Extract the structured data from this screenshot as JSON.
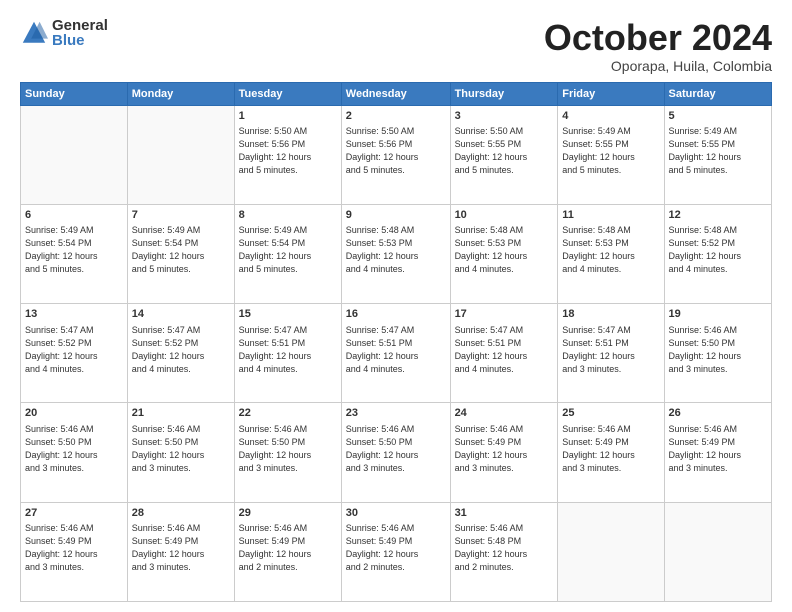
{
  "logo": {
    "general": "General",
    "blue": "Blue"
  },
  "header": {
    "month": "October 2024",
    "location": "Oporapa, Huila, Colombia"
  },
  "weekdays": [
    "Sunday",
    "Monday",
    "Tuesday",
    "Wednesday",
    "Thursday",
    "Friday",
    "Saturday"
  ],
  "weeks": [
    [
      {
        "day": "",
        "info": ""
      },
      {
        "day": "",
        "info": ""
      },
      {
        "day": "1",
        "info": "Sunrise: 5:50 AM\nSunset: 5:56 PM\nDaylight: 12 hours\nand 5 minutes."
      },
      {
        "day": "2",
        "info": "Sunrise: 5:50 AM\nSunset: 5:56 PM\nDaylight: 12 hours\nand 5 minutes."
      },
      {
        "day": "3",
        "info": "Sunrise: 5:50 AM\nSunset: 5:55 PM\nDaylight: 12 hours\nand 5 minutes."
      },
      {
        "day": "4",
        "info": "Sunrise: 5:49 AM\nSunset: 5:55 PM\nDaylight: 12 hours\nand 5 minutes."
      },
      {
        "day": "5",
        "info": "Sunrise: 5:49 AM\nSunset: 5:55 PM\nDaylight: 12 hours\nand 5 minutes."
      }
    ],
    [
      {
        "day": "6",
        "info": "Sunrise: 5:49 AM\nSunset: 5:54 PM\nDaylight: 12 hours\nand 5 minutes."
      },
      {
        "day": "7",
        "info": "Sunrise: 5:49 AM\nSunset: 5:54 PM\nDaylight: 12 hours\nand 5 minutes."
      },
      {
        "day": "8",
        "info": "Sunrise: 5:49 AM\nSunset: 5:54 PM\nDaylight: 12 hours\nand 5 minutes."
      },
      {
        "day": "9",
        "info": "Sunrise: 5:48 AM\nSunset: 5:53 PM\nDaylight: 12 hours\nand 4 minutes."
      },
      {
        "day": "10",
        "info": "Sunrise: 5:48 AM\nSunset: 5:53 PM\nDaylight: 12 hours\nand 4 minutes."
      },
      {
        "day": "11",
        "info": "Sunrise: 5:48 AM\nSunset: 5:53 PM\nDaylight: 12 hours\nand 4 minutes."
      },
      {
        "day": "12",
        "info": "Sunrise: 5:48 AM\nSunset: 5:52 PM\nDaylight: 12 hours\nand 4 minutes."
      }
    ],
    [
      {
        "day": "13",
        "info": "Sunrise: 5:47 AM\nSunset: 5:52 PM\nDaylight: 12 hours\nand 4 minutes."
      },
      {
        "day": "14",
        "info": "Sunrise: 5:47 AM\nSunset: 5:52 PM\nDaylight: 12 hours\nand 4 minutes."
      },
      {
        "day": "15",
        "info": "Sunrise: 5:47 AM\nSunset: 5:51 PM\nDaylight: 12 hours\nand 4 minutes."
      },
      {
        "day": "16",
        "info": "Sunrise: 5:47 AM\nSunset: 5:51 PM\nDaylight: 12 hours\nand 4 minutes."
      },
      {
        "day": "17",
        "info": "Sunrise: 5:47 AM\nSunset: 5:51 PM\nDaylight: 12 hours\nand 4 minutes."
      },
      {
        "day": "18",
        "info": "Sunrise: 5:47 AM\nSunset: 5:51 PM\nDaylight: 12 hours\nand 3 minutes."
      },
      {
        "day": "19",
        "info": "Sunrise: 5:46 AM\nSunset: 5:50 PM\nDaylight: 12 hours\nand 3 minutes."
      }
    ],
    [
      {
        "day": "20",
        "info": "Sunrise: 5:46 AM\nSunset: 5:50 PM\nDaylight: 12 hours\nand 3 minutes."
      },
      {
        "day": "21",
        "info": "Sunrise: 5:46 AM\nSunset: 5:50 PM\nDaylight: 12 hours\nand 3 minutes."
      },
      {
        "day": "22",
        "info": "Sunrise: 5:46 AM\nSunset: 5:50 PM\nDaylight: 12 hours\nand 3 minutes."
      },
      {
        "day": "23",
        "info": "Sunrise: 5:46 AM\nSunset: 5:50 PM\nDaylight: 12 hours\nand 3 minutes."
      },
      {
        "day": "24",
        "info": "Sunrise: 5:46 AM\nSunset: 5:49 PM\nDaylight: 12 hours\nand 3 minutes."
      },
      {
        "day": "25",
        "info": "Sunrise: 5:46 AM\nSunset: 5:49 PM\nDaylight: 12 hours\nand 3 minutes."
      },
      {
        "day": "26",
        "info": "Sunrise: 5:46 AM\nSunset: 5:49 PM\nDaylight: 12 hours\nand 3 minutes."
      }
    ],
    [
      {
        "day": "27",
        "info": "Sunrise: 5:46 AM\nSunset: 5:49 PM\nDaylight: 12 hours\nand 3 minutes."
      },
      {
        "day": "28",
        "info": "Sunrise: 5:46 AM\nSunset: 5:49 PM\nDaylight: 12 hours\nand 3 minutes."
      },
      {
        "day": "29",
        "info": "Sunrise: 5:46 AM\nSunset: 5:49 PM\nDaylight: 12 hours\nand 2 minutes."
      },
      {
        "day": "30",
        "info": "Sunrise: 5:46 AM\nSunset: 5:49 PM\nDaylight: 12 hours\nand 2 minutes."
      },
      {
        "day": "31",
        "info": "Sunrise: 5:46 AM\nSunset: 5:48 PM\nDaylight: 12 hours\nand 2 minutes."
      },
      {
        "day": "",
        "info": ""
      },
      {
        "day": "",
        "info": ""
      }
    ]
  ]
}
